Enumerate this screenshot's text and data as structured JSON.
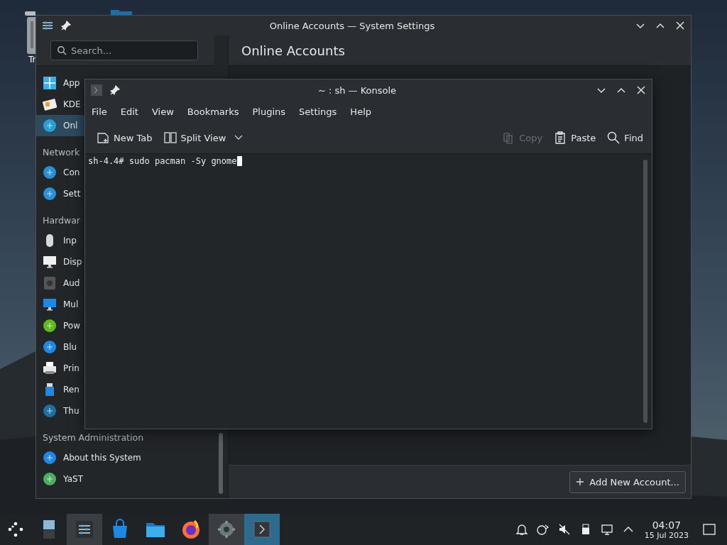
{
  "desktop": {
    "trash_label": "Tr"
  },
  "settings_window": {
    "title": "Online Accounts — System Settings",
    "search": {
      "placeholder": "Search..."
    },
    "page_title": "Online Accounts",
    "sidebar": [
      {
        "kind": "item",
        "label": "App",
        "selected": false
      },
      {
        "kind": "item",
        "label": "KDE",
        "selected": false
      },
      {
        "kind": "item",
        "label": "Onl",
        "selected": true
      },
      {
        "kind": "header",
        "label": "Network"
      },
      {
        "kind": "item",
        "label": "Con",
        "selected": false
      },
      {
        "kind": "item",
        "label": "Sett",
        "selected": false
      },
      {
        "kind": "header",
        "label": "Hardwar"
      },
      {
        "kind": "item",
        "label": "Inp",
        "selected": false
      },
      {
        "kind": "item",
        "label": "Disp",
        "selected": false
      },
      {
        "kind": "item",
        "label": "Aud",
        "selected": false
      },
      {
        "kind": "item",
        "label": "Mul",
        "selected": false
      },
      {
        "kind": "item",
        "label": "Pow",
        "selected": false
      },
      {
        "kind": "item",
        "label": "Blu",
        "selected": false
      },
      {
        "kind": "item",
        "label": "Prin",
        "selected": false
      },
      {
        "kind": "item",
        "label": "Ren",
        "selected": false
      },
      {
        "kind": "item",
        "label": "Thu",
        "selected": false
      },
      {
        "kind": "header",
        "label": "System Administration"
      },
      {
        "kind": "item",
        "label": "About this System",
        "selected": false
      },
      {
        "kind": "item",
        "label": "YaST",
        "selected": false
      }
    ],
    "add_button": "Add New Account..."
  },
  "konsole": {
    "title": "~ : sh — Konsole",
    "menu": [
      "File",
      "Edit",
      "View",
      "Bookmarks",
      "Plugins",
      "Settings",
      "Help"
    ],
    "toolbar_left": [
      {
        "label": "New Tab",
        "disabled": false
      },
      {
        "label": "Split View",
        "disabled": false
      }
    ],
    "toolbar_right": [
      {
        "label": "Copy",
        "disabled": true
      },
      {
        "label": "Paste",
        "disabled": false
      },
      {
        "label": "Find",
        "disabled": false
      }
    ],
    "terminal_line": "sh-4.4# sudo pacman -Sy gnome"
  },
  "taskbar": {
    "tasks": [
      {
        "open": false,
        "active": false
      },
      {
        "open": true,
        "active": false
      },
      {
        "open": false,
        "active": false
      },
      {
        "open": false,
        "active": false
      },
      {
        "open": false,
        "active": false
      },
      {
        "open": true,
        "active": false
      },
      {
        "open": true,
        "active": true
      }
    ],
    "time": "04:07",
    "date": "15 Jul 2023"
  }
}
